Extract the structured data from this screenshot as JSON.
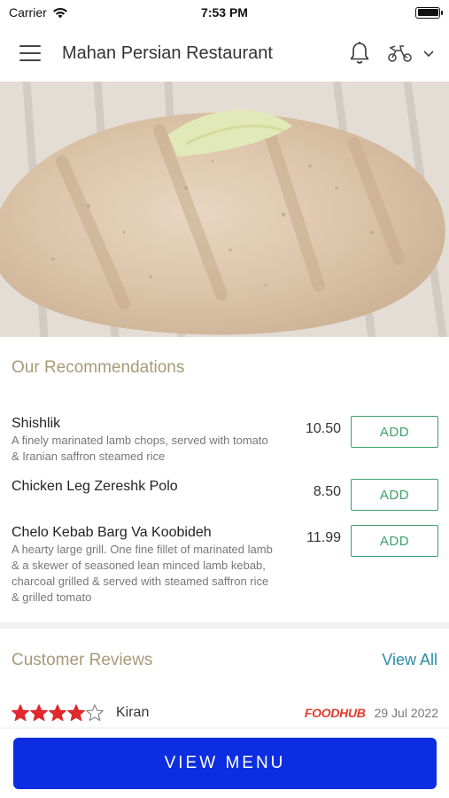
{
  "status_bar": {
    "carrier": "Carrier",
    "time": "7:53 PM"
  },
  "header": {
    "title": "Mahan Persian Restaurant"
  },
  "recommendations": {
    "title": "Our Recommendations",
    "add_label": "ADD",
    "items": [
      {
        "name": "Shishlik",
        "description": "A finely marinated lamb chops, served with tomato & Iranian saffron steamed rice",
        "price": "10.50"
      },
      {
        "name": "Chicken Leg Zereshk Polo",
        "description": "",
        "price": "8.50"
      },
      {
        "name": "Chelo Kebab Barg Va Koobideh",
        "description": "A hearty large grill. One fine fillet of marinated lamb & a skewer of seasoned lean minced lamb kebab, charcoal grilled & served with steamed saffron rice & grilled tomato",
        "price": "11.99"
      }
    ]
  },
  "reviews": {
    "title": "Customer Reviews",
    "view_all": "View All",
    "items": [
      {
        "reviewer": "Kiran",
        "rating": 4,
        "max_rating": 5,
        "source": "FOODHUB",
        "date": "29 Jul 2022"
      }
    ]
  },
  "bottom": {
    "view_menu": "VIEW MENU"
  },
  "colors": {
    "accent": "#0d2ee0",
    "add_green": "#3aa06a",
    "section_title": "#a89a78",
    "link": "#2a8ba8",
    "star": "#e0282e",
    "foodhub": "#e23b2e"
  },
  "icons": [
    "wifi-icon",
    "battery-icon",
    "hamburger-menu-icon",
    "bell-icon",
    "scooter-icon",
    "chevron-down-icon",
    "star-icon"
  ]
}
